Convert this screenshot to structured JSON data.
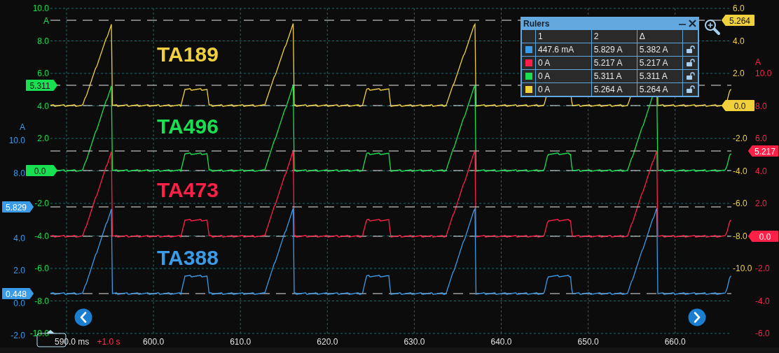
{
  "traces": [
    {
      "name": "TA189",
      "color": "#f0d03c",
      "ticks": [
        "6.0",
        "4.0",
        "2.0",
        "-2.0",
        "-4.0",
        "-6.0",
        "-8.0",
        "-10.0"
      ],
      "tags": [
        "5.264",
        "0.0"
      ]
    },
    {
      "name": "TA496",
      "color": "#18e050",
      "unit": "A",
      "ticks": [
        "10.0",
        "8.0",
        "6.0",
        "4.0",
        "2.0",
        "-2.0",
        "-4.0",
        "-6.0",
        "-8.0",
        "-10.0"
      ],
      "tags": [
        "5.311",
        "0.0"
      ]
    },
    {
      "name": "TA473",
      "color": "#ff2048",
      "unit": "A",
      "ticks": [
        "10.0",
        "8.0",
        "6.0",
        "4.0",
        "2.0",
        "-2.0",
        "-4.0",
        "-6.0"
      ],
      "tags": [
        "5.217",
        "0.0"
      ]
    },
    {
      "name": "TA388",
      "color": "#3a9be8",
      "unit": "A",
      "ticks": [
        "10.0",
        "8.0",
        "4.0",
        "2.0",
        "0.0",
        "-2.0"
      ],
      "tags": [
        "5.829",
        "0.448"
      ]
    }
  ],
  "rulers": {
    "title": "Rulers",
    "columns": [
      "1",
      "2",
      "Δ"
    ],
    "rows": [
      {
        "color": "#3a9be8",
        "values": [
          "447.6 mA",
          "5.829 A",
          "5.382 A"
        ]
      },
      {
        "color": "#ff2048",
        "values": [
          "0 A",
          "5.217 A",
          "5.217 A"
        ]
      },
      {
        "color": "#18e050",
        "values": [
          "0 A",
          "5.311 A",
          "5.311 A"
        ]
      },
      {
        "color": "#f0d03c",
        "values": [
          "0 A",
          "5.264 A",
          "5.264 A"
        ]
      }
    ]
  },
  "time_axis": {
    "start": "590.0 ms",
    "offset": "+1.0 s",
    "ticks": [
      "600.0",
      "610.0",
      "620.0",
      "630.0",
      "640.0",
      "650.0",
      "660.0"
    ]
  }
}
